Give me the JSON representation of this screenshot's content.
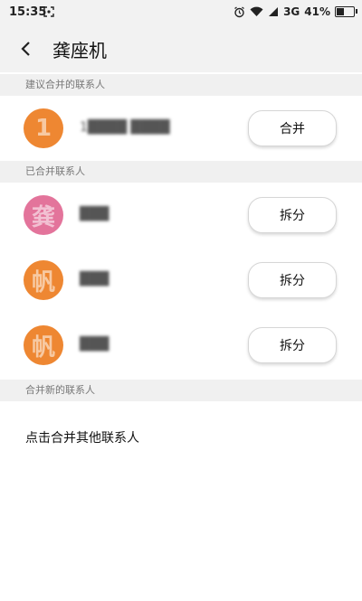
{
  "status_bar": {
    "time": "15:35",
    "network": "3G",
    "battery": "41%",
    "battery_level": 0.41
  },
  "header": {
    "title": "龚座机"
  },
  "sections": {
    "suggested": "建议合并的联系人",
    "merged": "已合并联系人",
    "new": "合并新的联系人"
  },
  "suggested_contacts": [
    {
      "avatar_text": "1",
      "avatar_color": "#ee8732",
      "name": "1████ ████",
      "button": "合并"
    }
  ],
  "merged_contacts": [
    {
      "avatar_text": "龚",
      "avatar_color": "#e3749b",
      "name": "███",
      "button": "拆分"
    },
    {
      "avatar_text": "帆",
      "avatar_color": "#ee8732",
      "name": "███",
      "button": "拆分"
    },
    {
      "avatar_text": "帆",
      "avatar_color": "#ee8732",
      "name": "███",
      "button": "拆分"
    }
  ],
  "merge_others_label": "点击合并其他联系人"
}
